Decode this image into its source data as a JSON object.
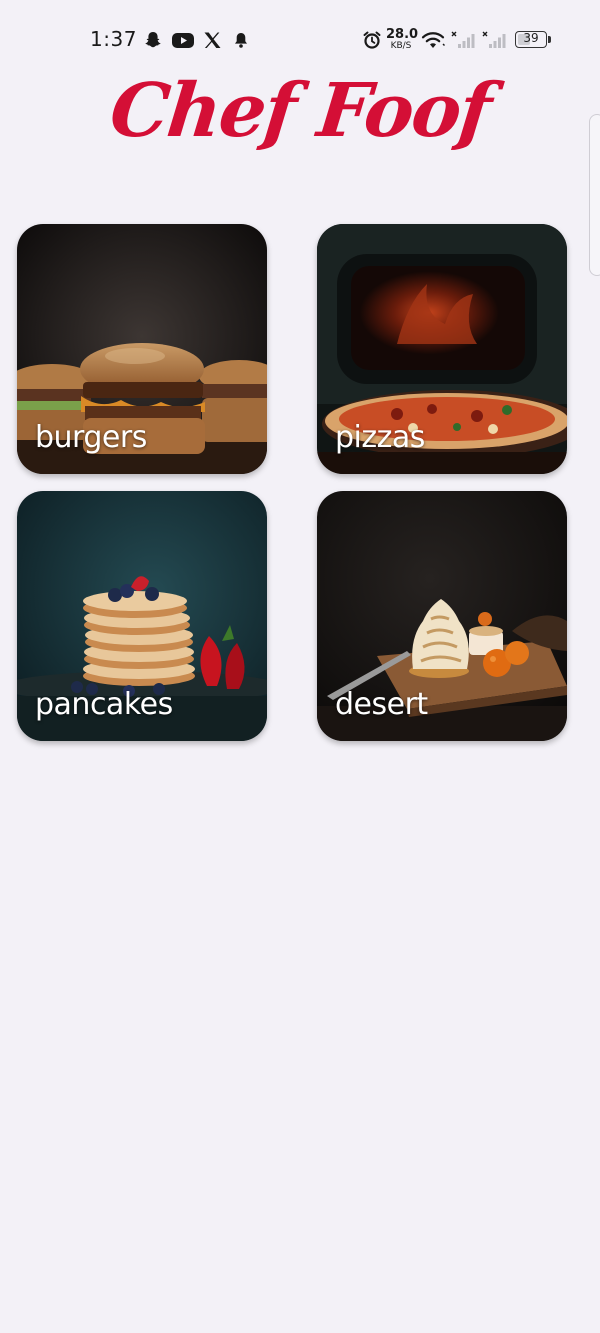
{
  "status_bar": {
    "time": "1:37",
    "net_speed_value": "28.0",
    "net_speed_unit": "KB/S",
    "battery": "39",
    "battery_level": 0.39,
    "icons": [
      "snapchat-icon",
      "youtube-icon",
      "x-icon",
      "notification-bell-icon",
      "alarm-icon",
      "wifi-icon",
      "signal-icon",
      "signal-icon",
      "battery-icon"
    ]
  },
  "header": {
    "title": "Chef Foof",
    "title_color": "#d40f36"
  },
  "categories": [
    {
      "label": "burgers"
    },
    {
      "label": "pizzas"
    },
    {
      "label": "pancakes"
    },
    {
      "label": "desert"
    }
  ],
  "colors": {
    "background": "#f3f1f7",
    "card_label": "#ffffff"
  }
}
